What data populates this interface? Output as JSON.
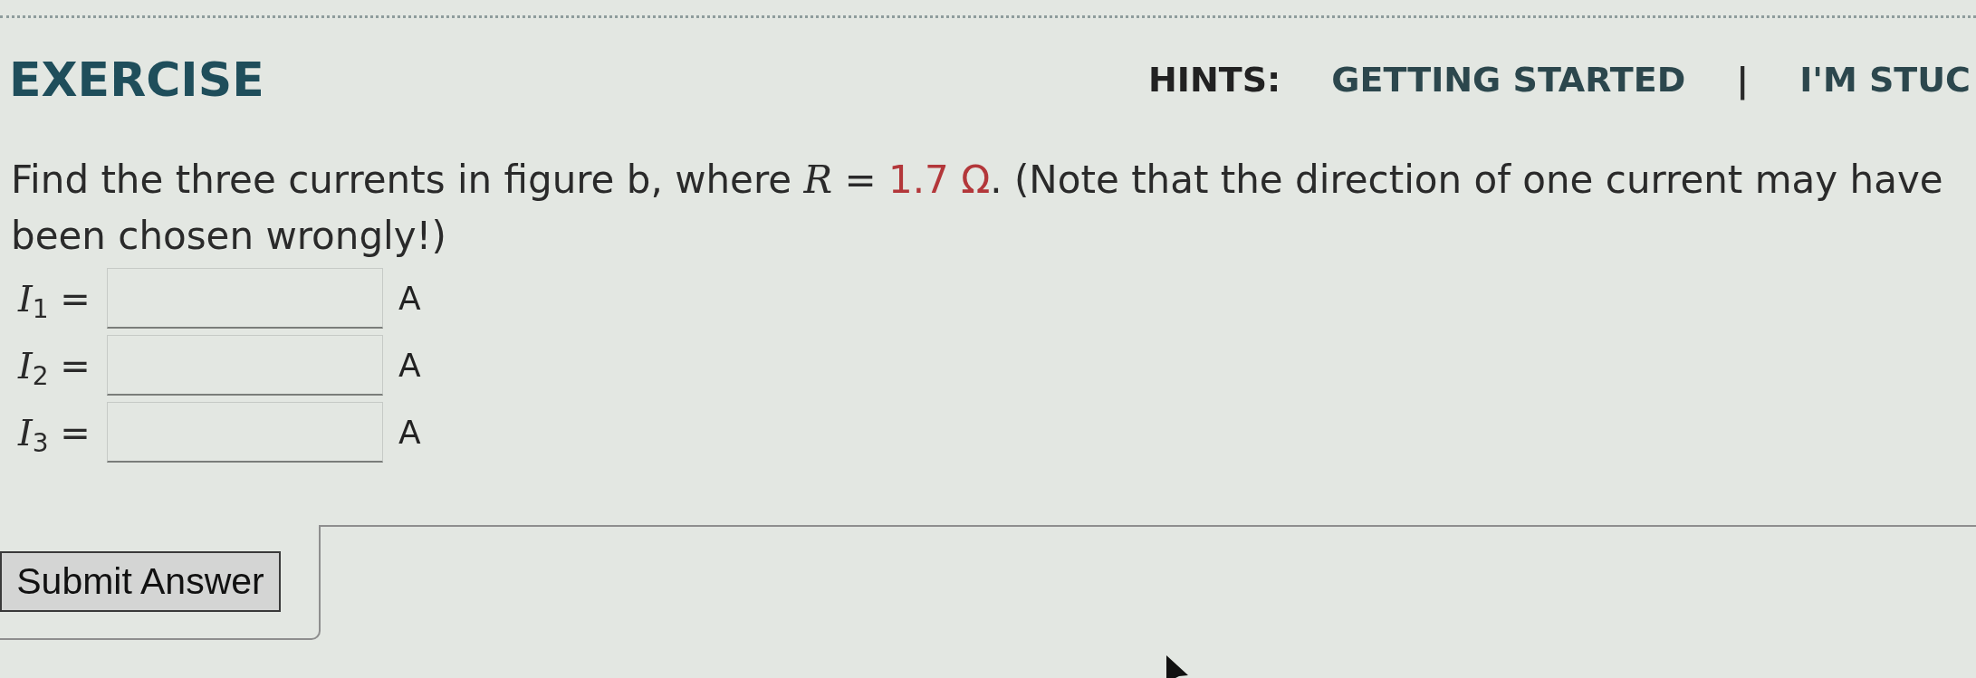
{
  "header": {
    "title": "EXERCISE",
    "hints": {
      "label": "HINTS:",
      "separator": "|",
      "links": [
        {
          "text": "GETTING STARTED"
        },
        {
          "text": "I'M STUC"
        }
      ]
    }
  },
  "question": {
    "text_before": "Find the three currents in figure b, where *R* =",
    "value": "1.7 Ω",
    "text_after": ". (Note that the direction of one current may have been chosen wrongly!)"
  },
  "answers": [
    {
      "label": "*I*$_{1}$ =",
      "unit": "A"
    },
    {
      "label": "*I*$_{2}$ =",
      "unit": "A"
    },
    {
      "label": "*I*$_{3}$ =",
      "unit": "A"
    }
  ],
  "submit_button": {
    "label": "Submit Answer"
  }
}
